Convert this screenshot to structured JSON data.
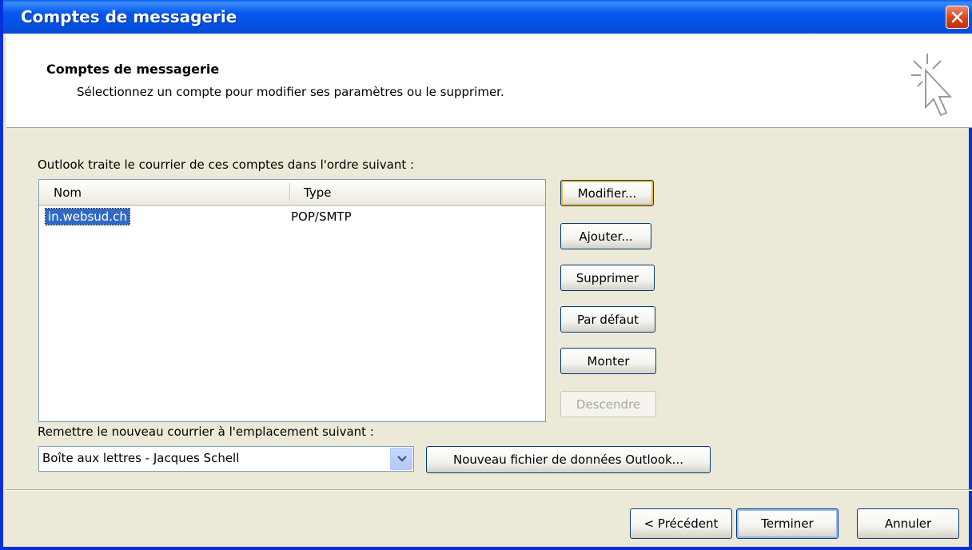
{
  "window": {
    "title": "Comptes de messagerie"
  },
  "header": {
    "title": "Comptes de messagerie",
    "subtitle": "Sélectionnez un compte pour modifier ses paramètres ou le supprimer."
  },
  "accounts": {
    "label": "Outlook traite le courrier de ces comptes dans l'ordre suivant :",
    "columns": [
      "Nom",
      "Type"
    ],
    "rows": [
      {
        "name": "in.websud.ch",
        "type": "POP/SMTP",
        "selected": true
      }
    ]
  },
  "actions": {
    "modify": "Modifier...",
    "add": "Ajouter...",
    "remove": "Supprimer",
    "default": "Par défaut",
    "up": "Monter",
    "down": "Descendre"
  },
  "delivery": {
    "label": "Remettre le nouveau courrier à l'emplacement suivant :",
    "selected": "Boîte aux lettres - Jacques Schell",
    "new_data_file": "Nouveau fichier de données Outlook..."
  },
  "footer": {
    "back": "< Précédent",
    "finish": "Terminer",
    "cancel": "Annuler"
  },
  "colors": {
    "titlebar": "#0558ee",
    "selection": "#316ac5",
    "dialog_bg": "#ece9d8",
    "close_button": "#d5441c"
  }
}
